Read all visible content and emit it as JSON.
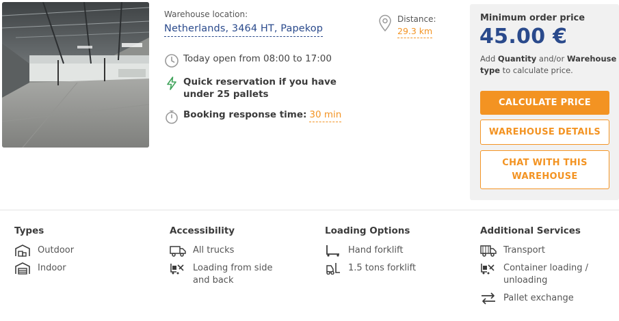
{
  "location": {
    "label": "Warehouse location:",
    "value": "Netherlands, 3464 HT, Papekop"
  },
  "distance": {
    "label": "Distance:",
    "value": "29.3 km",
    "icon": "map-pin-icon"
  },
  "hours": {
    "text": "Today open from 08:00 to 17:00",
    "icon": "clock-icon"
  },
  "quick_reservation": {
    "text": "Quick reservation if you have under 25 pallets",
    "icon": "lightning-icon"
  },
  "booking": {
    "label": "Booking response time:",
    "value": "30 min",
    "icon": "stopwatch-icon"
  },
  "price_panel": {
    "label": "Minimum order price",
    "price": "45.00 €",
    "note_prefix": "Add ",
    "note_quantity": "Quantity",
    "note_mid": " and/or ",
    "note_type_a": "Warehouse",
    "note_type_b": "type",
    "note_suffix": " to calculate price.",
    "calculate_label": "CALCULATE PRICE",
    "details_label": "WAREHOUSE DETAILS",
    "chat_label": "CHAT WITH THIS WAREHOUSE"
  },
  "features": {
    "types": {
      "title": "Types",
      "items": [
        {
          "label": "Outdoor",
          "icon": "outdoor-warehouse-icon"
        },
        {
          "label": "Indoor",
          "icon": "indoor-warehouse-icon"
        }
      ]
    },
    "accessibility": {
      "title": "Accessibility",
      "items": [
        {
          "label": "All trucks",
          "icon": "truck-icon"
        },
        {
          "label": "Loading from side and back",
          "icon": "forklift-loading-icon"
        }
      ]
    },
    "loading": {
      "title": "Loading Options",
      "items": [
        {
          "label": "Hand forklift",
          "icon": "hand-forklift-icon"
        },
        {
          "label": "1.5 tons forklift",
          "icon": "forklift-icon"
        }
      ]
    },
    "services": {
      "title": "Additional Services",
      "items": [
        {
          "label": "Transport",
          "icon": "transport-truck-icon"
        },
        {
          "label": "Container loading / unloading",
          "icon": "container-loading-icon"
        },
        {
          "label": "Pallet exchange",
          "icon": "exchange-arrows-icon"
        }
      ]
    }
  },
  "colors": {
    "accent": "#f39322",
    "brand_blue": "#2a4a8c",
    "panel_bg": "#f1f1f1"
  }
}
